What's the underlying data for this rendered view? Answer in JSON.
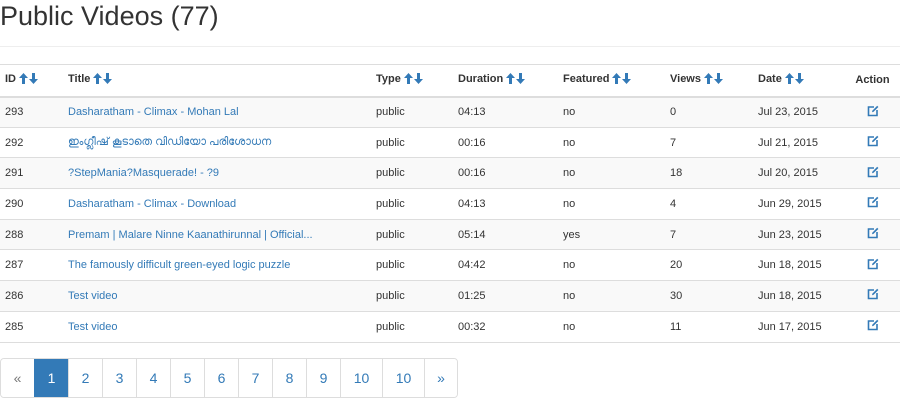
{
  "page": {
    "title": "Public Videos (77)"
  },
  "colors": {
    "link": "#337ab7",
    "active_page_bg": "#337ab7",
    "border": "#dddddd",
    "stripe": "#f9f9f9"
  },
  "icons": {
    "sort_asc": "arrow-up-icon",
    "sort_desc": "arrow-down-icon",
    "action": "edit-icon"
  },
  "table": {
    "columns": [
      {
        "key": "id",
        "label": "ID",
        "sortable": true
      },
      {
        "key": "title",
        "label": "Title",
        "sortable": true
      },
      {
        "key": "type",
        "label": "Type",
        "sortable": true
      },
      {
        "key": "duration",
        "label": "Duration",
        "sortable": true
      },
      {
        "key": "featured",
        "label": "Featured",
        "sortable": true
      },
      {
        "key": "views",
        "label": "Views",
        "sortable": true
      },
      {
        "key": "date",
        "label": "Date",
        "sortable": true
      },
      {
        "key": "action",
        "label": "Action",
        "sortable": false
      }
    ],
    "rows": [
      {
        "id": "293",
        "title": "Dasharatham - Climax - Mohan Lal",
        "type": "public",
        "duration": "04:13",
        "featured": "no",
        "views": "0",
        "date": "Jul 23, 2015"
      },
      {
        "id": "292",
        "title": "ഇംഗ്ലീഷ് കൂടാതെ വിഡിയോ പരിശോധന",
        "type": "public",
        "duration": "00:16",
        "featured": "no",
        "views": "7",
        "date": "Jul 21, 2015"
      },
      {
        "id": "291",
        "title": "?StepMania?Masquerade! - ?9",
        "type": "public",
        "duration": "00:16",
        "featured": "no",
        "views": "18",
        "date": "Jul 20, 2015"
      },
      {
        "id": "290",
        "title": "Dasharatham - Climax - Download",
        "type": "public",
        "duration": "04:13",
        "featured": "no",
        "views": "4",
        "date": "Jun 29, 2015"
      },
      {
        "id": "288",
        "title": "Premam | Malare Ninne Kaanathirunnal | Official...",
        "type": "public",
        "duration": "05:14",
        "featured": "yes",
        "views": "7",
        "date": "Jun 23, 2015"
      },
      {
        "id": "287",
        "title": "The famously difficult green-eyed logic puzzle",
        "type": "public",
        "duration": "04:42",
        "featured": "no",
        "views": "20",
        "date": "Jun 18, 2015"
      },
      {
        "id": "286",
        "title": "Test video",
        "type": "public",
        "duration": "01:25",
        "featured": "no",
        "views": "30",
        "date": "Jun 18, 2015"
      },
      {
        "id": "285",
        "title": "Test video",
        "type": "public",
        "duration": "00:32",
        "featured": "no",
        "views": "11",
        "date": "Jun 17, 2015"
      }
    ]
  },
  "pagination": {
    "items": [
      {
        "label": "«",
        "state": "disabled"
      },
      {
        "label": "1",
        "state": "active"
      },
      {
        "label": "2",
        "state": "normal"
      },
      {
        "label": "3",
        "state": "normal"
      },
      {
        "label": "4",
        "state": "normal"
      },
      {
        "label": "5",
        "state": "normal"
      },
      {
        "label": "6",
        "state": "normal"
      },
      {
        "label": "7",
        "state": "normal"
      },
      {
        "label": "8",
        "state": "normal"
      },
      {
        "label": "9",
        "state": "normal"
      },
      {
        "label": "10",
        "state": "normal"
      },
      {
        "label": "10",
        "state": "normal"
      },
      {
        "label": "»",
        "state": "normal"
      }
    ]
  }
}
